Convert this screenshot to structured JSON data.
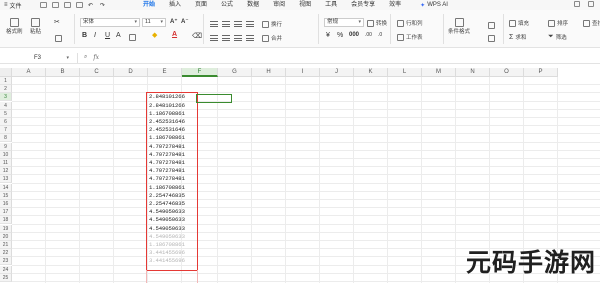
{
  "menubar": {
    "file": "文件",
    "menus": [
      "开始",
      "插入",
      "页面",
      "公式",
      "数据",
      "审阅",
      "视图",
      "工具",
      "会员专享",
      "效率"
    ],
    "active_menu": "开始",
    "wps_ai": "WPS AI"
  },
  "ribbon": {
    "format_painter": "格式刷",
    "paste": "粘贴",
    "font_name": "宋体",
    "font_size": "11",
    "wrap": "换行",
    "merge": "合并",
    "number_format": "常规",
    "convert": "转换",
    "row_col": "行和列",
    "worksheet": "工作表",
    "cond_format": "条件格式",
    "fill": "填充",
    "sum": "求和",
    "sort": "排序",
    "filter": "筛选",
    "find": "查找"
  },
  "formula_bar": {
    "name_box": "F3",
    "fx": "fx"
  },
  "columns": [
    "A",
    "B",
    "C",
    "D",
    "E",
    "F",
    "G",
    "H",
    "I",
    "J",
    "K",
    "L",
    "M",
    "N",
    "O",
    "P"
  ],
  "active_column": "F",
  "rows": [
    "1",
    "2",
    "3",
    "4",
    "5",
    "6",
    "7",
    "8",
    "9",
    "10",
    "11",
    "12",
    "13",
    "14",
    "15",
    "16",
    "17",
    "18",
    "19",
    "20",
    "21",
    "22",
    "23",
    "24",
    "25"
  ],
  "active_row": "3",
  "cells_e": [
    "2.848101266",
    "2.848101266",
    "1.186708861",
    "2.452531646",
    "2.452531646",
    "1.186708861",
    "4.707278481",
    "4.707278481",
    "4.707278481",
    "4.707278481",
    "4.707278481",
    "1.186708861",
    "2.254746835",
    "2.254746835",
    "4.549050633",
    "4.549050633",
    "4.549050633",
    "4.549050633",
    "1.186708861",
    "3.441455696",
    "3.441455696"
  ],
  "watermark": "元码手游网"
}
